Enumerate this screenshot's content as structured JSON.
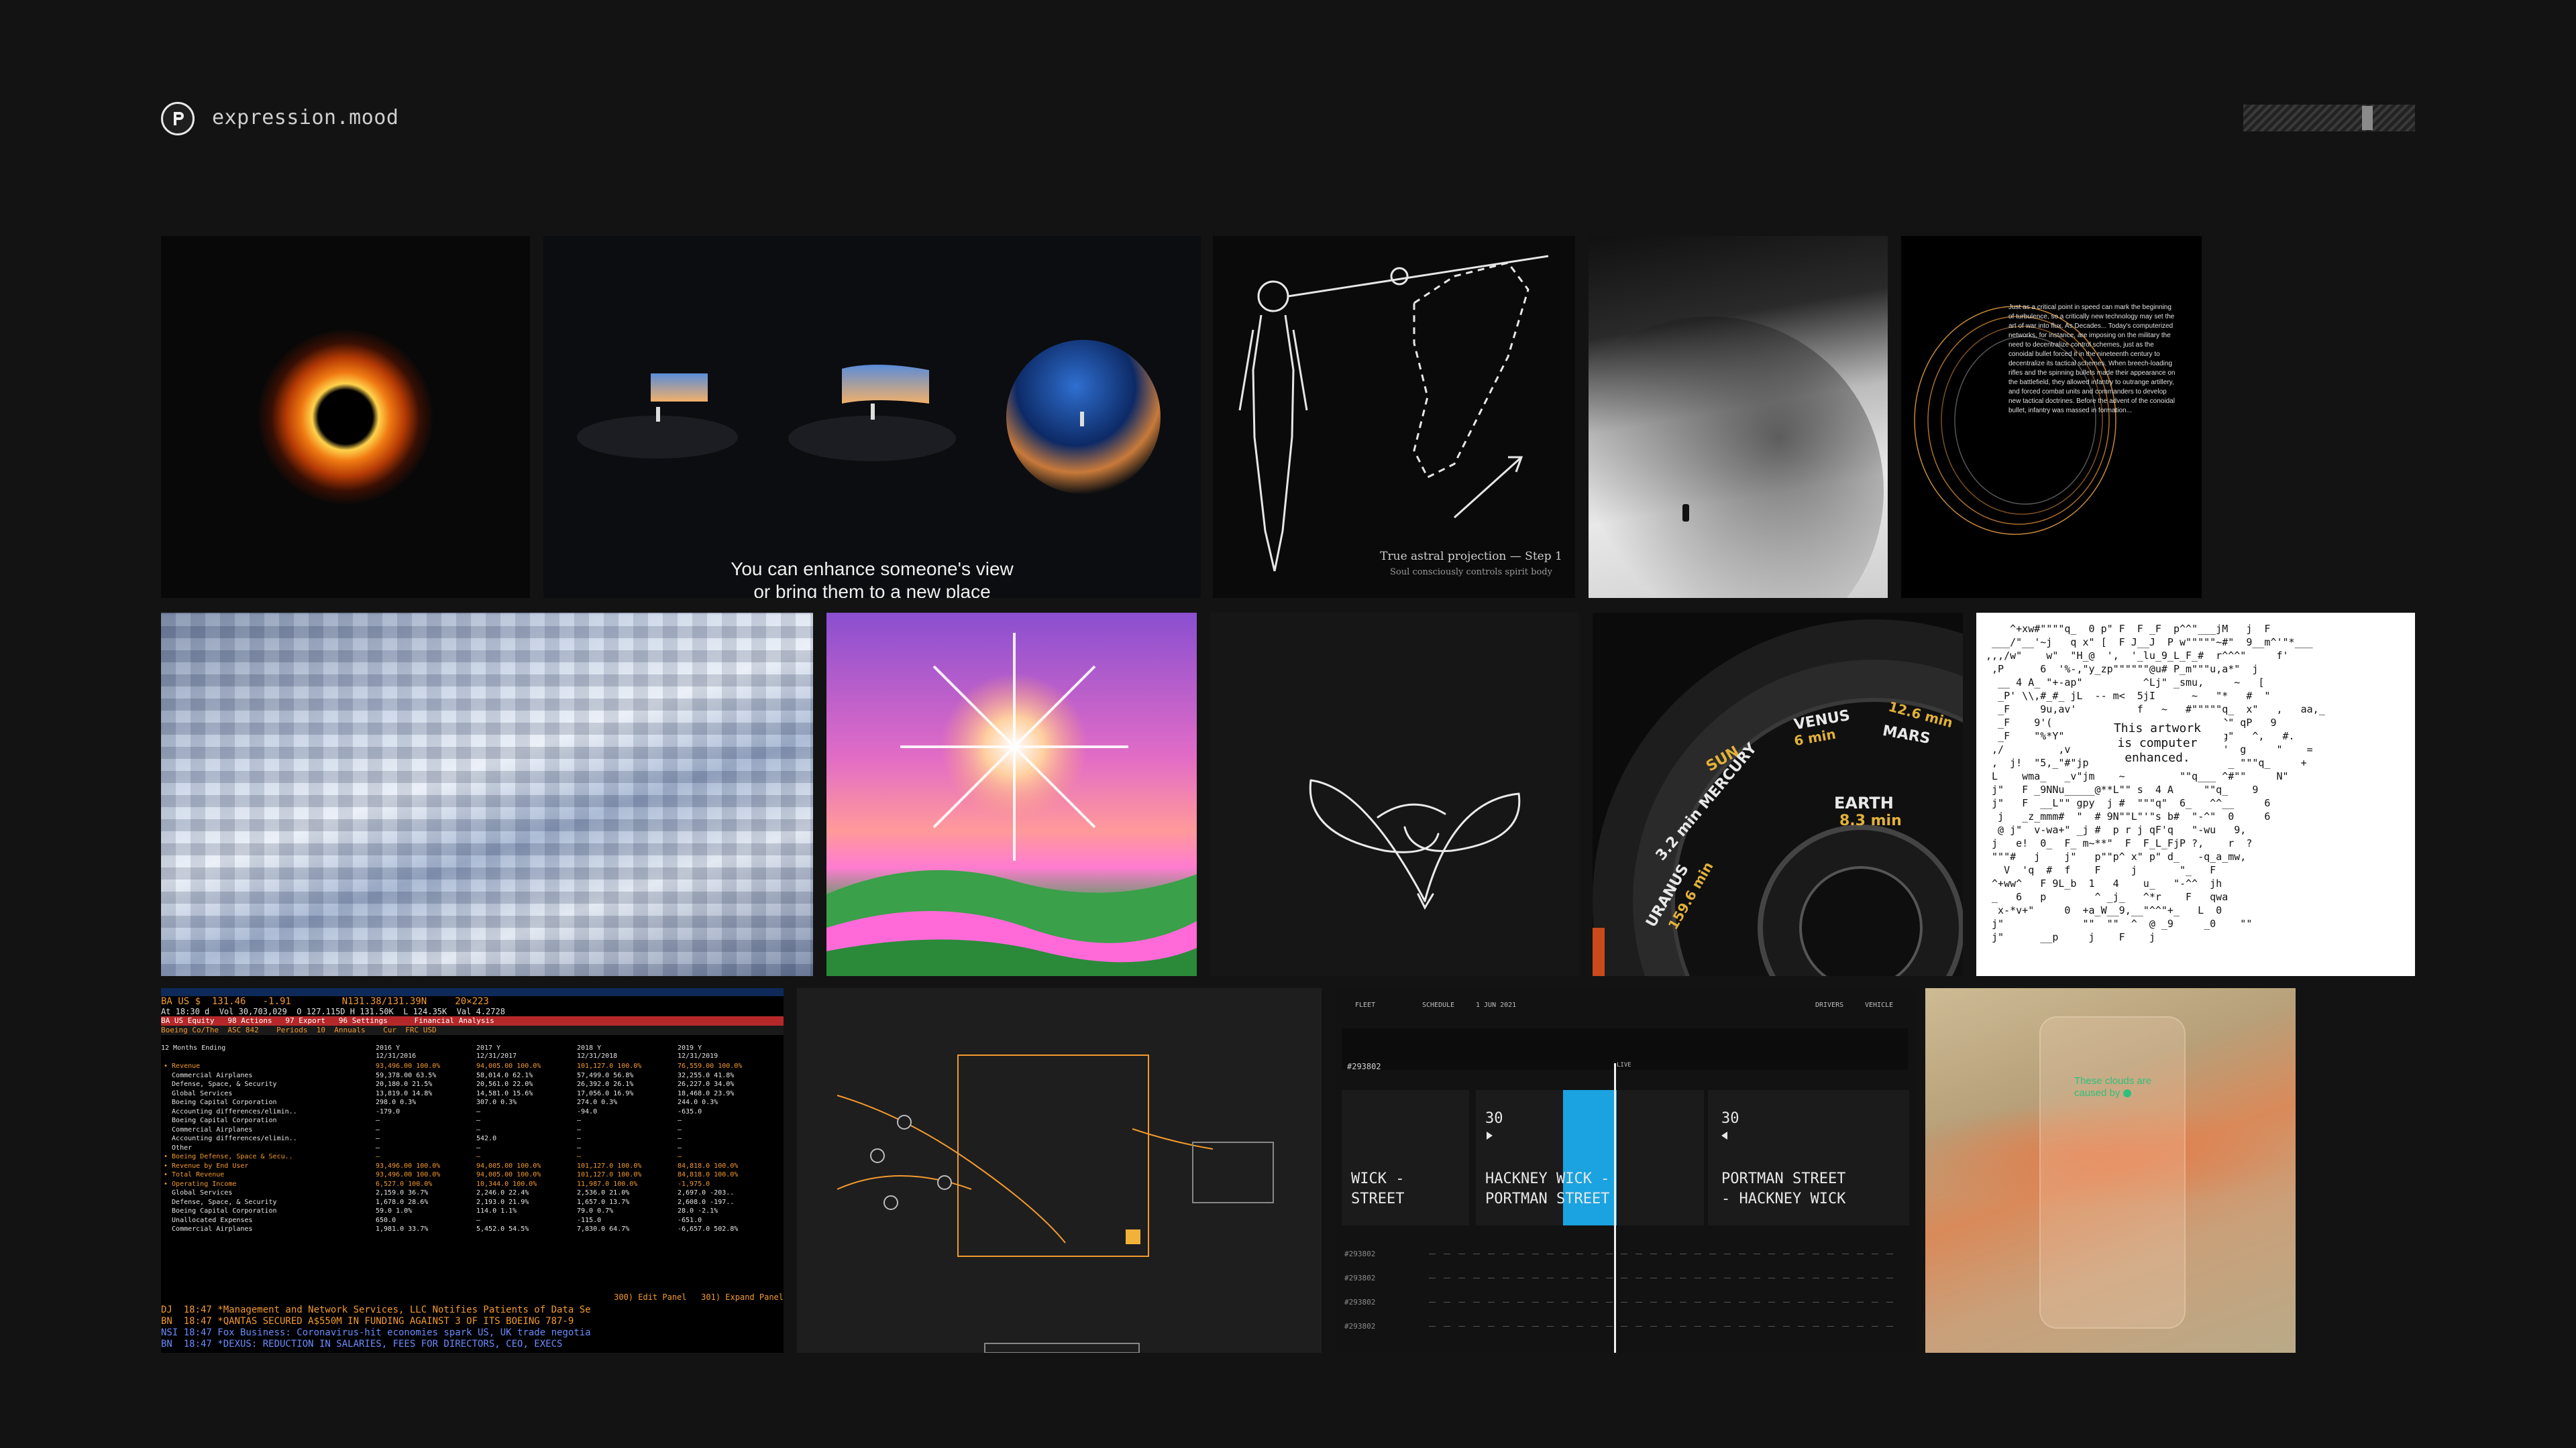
{
  "site": {
    "title": "expression.mood",
    "logo_letter": "P"
  },
  "colors": {
    "background": "#131313",
    "accent_orange": "#f29a2e",
    "accent_blue": "#1aa3e0"
  },
  "tiles": {
    "vr": {
      "caption_line1": "You can enhance someone's view",
      "caption_line2": "or bring them to a new place"
    },
    "astral": {
      "caption_title": "True astral projection — Step 1",
      "caption_sub": "Soul consciously controls spirit body"
    },
    "text_art": {
      "body": "Just as a critical point in speed can mark the beginning of turbulence, so a critically new technology may set the art of war into flux. As Decades... Today's computerized networks, for instance, are imposing on the military the need to decentralize control schemes, just as the conoidal bullet forced it in the nineteenth century to decentralize its tactical schemes. When breech-loading rifles and the spinning bullets made their appearance on the battlefield, they allowed infantry to outrange artillery, and forced combat units and commanders to develop new tactical doctrines. Before the advent of the conoidal bullet, infantry was massed in formation..."
    },
    "watch": {
      "venus": "VENUS",
      "venus_time": "6 min",
      "mars": "MARS",
      "mars_time": "12.6 min",
      "sun": "SUN",
      "mercury": "3.2 min MERCURY",
      "earth": "EARTH",
      "earth_time": "8.3 min",
      "uranus": "URANUS",
      "uranus_time": "159.6 min"
    },
    "ascii": {
      "message_line1": "This artwork",
      "message_line2": "is computer",
      "message_line3": "enhanced."
    },
    "bloomberg": {
      "ticker_line": "BA US $  131.46   -1.91         N131.38/131.39N     20×223",
      "sub_line": "At 18:30 d  Vol 30,703,029  O 127.115D H 131.50K  L 124.35K  Val 4.2728",
      "menu": "BA US Equity   98 Actions   97 Export   96 Settings      Financial Analysis",
      "company": "Boeing Co/The  ASC 842    Periods  10  Annuals    Cur  FRC USD",
      "section_title": "12 Months Ending",
      "col_headers": [
        "2016 Y",
        "2017 Y",
        "2018 Y",
        "2019 Y"
      ],
      "col_dates": [
        "12/31/2016",
        "12/31/2017",
        "12/31/2018",
        "12/31/2019"
      ],
      "rows": [
        {
          "label": "• Revenue",
          "v": [
            "93,496.00 100.0%",
            "94,005.00 100.0%",
            "101,127.0 100.0%",
            "76,559.00 100.0%"
          ]
        },
        {
          "label": "  Commercial Airplanes",
          "v": [
            "59,378.00 63.5%",
            "58,014.0 62.1%",
            "57,499.0 56.8%",
            "32,255.0 41.8%"
          ]
        },
        {
          "label": "  Defense, Space, & Security",
          "v": [
            "20,180.0 21.5%",
            "20,561.0 22.0%",
            "26,392.0 26.1%",
            "26,227.0 34.0%"
          ]
        },
        {
          "label": "  Global Services",
          "v": [
            "13,819.0 14.8%",
            "14,581.0 15.6%",
            "17,056.0 16.9%",
            "18,468.0 23.9%"
          ]
        },
        {
          "label": "  Boeing Capital Corporation",
          "v": [
            "298.0 0.3%",
            "307.0 0.3%",
            "274.0 0.3%",
            "244.0 0.3%"
          ]
        },
        {
          "label": "  Accounting differences/elimin..",
          "v": [
            "-179.0",
            "—",
            "-94.0",
            "-635.0"
          ]
        },
        {
          "label": "  Boeing Capital Corporation",
          "v": [
            "—",
            "—",
            "—",
            "—"
          ]
        },
        {
          "label": "  Commercial Airplanes",
          "v": [
            "—",
            "—",
            "—",
            "—"
          ]
        },
        {
          "label": "  Accounting differences/elimin..",
          "v": [
            "—",
            "542.0",
            "—",
            "—"
          ]
        },
        {
          "label": "  Other",
          "v": [
            "—",
            "—",
            "—",
            "—"
          ]
        },
        {
          "label": "• Boeing Defense, Space & Secu..",
          "v": [
            "—",
            "—",
            "—",
            "—"
          ]
        },
        {
          "label": "• Revenue by End User",
          "v": [
            "93,496.00 100.0%",
            "94,005.00 100.0%",
            "101,127.0 100.0%",
            "84,818.0 100.0%"
          ]
        },
        {
          "label": "• Total Revenue",
          "v": [
            "93,496.00 100.0%",
            "94,005.00 100.0%",
            "101,127.0 100.0%",
            "84,818.0 100.0%"
          ]
        },
        {
          "label": "• Operating Income",
          "v": [
            "6,527.0 100.0%",
            "10,344.0 100.0%",
            "11,987.0 100.0%",
            "-1,975.0"
          ]
        },
        {
          "label": "  Global Services",
          "v": [
            "2,159.0 36.7%",
            "2,246.0 22.4%",
            "2,536.0 21.0%",
            "2,697.0 -203.."
          ]
        },
        {
          "label": "  Defense, Space, & Security",
          "v": [
            "1,678.0 28.6%",
            "2,193.0 21.9%",
            "1,657.0 13.7%",
            "2,608.0 -197.."
          ]
        },
        {
          "label": "  Boeing Capital Corporation",
          "v": [
            "59.0 1.0%",
            "114.0 1.1%",
            "79.0 0.7%",
            "28.0 -2.1%"
          ]
        },
        {
          "label": "  Unallocated Expenses",
          "v": [
            "650.0",
            "—",
            "-115.0",
            "-651.0"
          ]
        },
        {
          "label": "  Commercial Airplanes",
          "v": [
            "1,981.0 33.7%",
            "5,452.0 54.5%",
            "7,830.0 64.7%",
            "-6,657.0 502.8%"
          ]
        }
      ],
      "panel_actions": "300) Edit Panel   301) Expand Panel",
      "news": [
        "DJ  18:47 *Management and Network Services, LLC Notifies Patients of Data Se",
        "BN  18:47 *QANTAS SECURED A$550M IN FUNDING AGAINST 3 OF ITS BOEING 787-9",
        "NSI 18:47 Fox Business: Coronavirus-hit economies spark US, UK trade negotia",
        "BN  18:47 *DEXUS: REDUCTION IN SALARIES, FEES FOR DIRECTORS, CEO, EXECS"
      ]
    },
    "transit": {
      "top_items": [
        "FLEET",
        "SCHEDULE",
        "1 JUN 2021",
        "DRIVERS",
        "VEHICLE"
      ],
      "id_main": "#293802",
      "live_label": "LIVE",
      "cards": [
        {
          "num": "",
          "line1": "WICK -",
          "line2": "STREET"
        },
        {
          "num": "30",
          "line1": "HACKNEY WICK -",
          "line2": "PORTMAN STREET"
        },
        {
          "num": "30",
          "line1": "PORTMAN STREET",
          "line2": "- HACKNEY WICK"
        }
      ],
      "row_ids": [
        "#293802",
        "#293802",
        "#293802",
        "#293802"
      ]
    },
    "clouds": {
      "line1": "These clouds are",
      "line2": "caused by"
    }
  }
}
